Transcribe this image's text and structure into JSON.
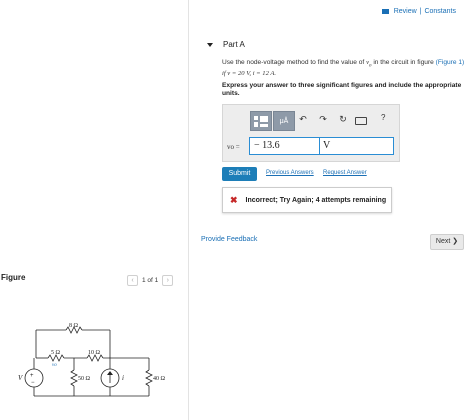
{
  "header": {
    "review_label": "Review",
    "separator": "|",
    "constants_label": "Constants"
  },
  "part": {
    "title": "Part A"
  },
  "problem": {
    "line1_prefix": "Use the node-voltage method to find the value of ",
    "line1_var": "v",
    "line1_sub": "o",
    "line1_mid": " in the circuit in figure ",
    "figure_link": "(Figure 1)",
    "line2": "if v = 20 V, i = 12 A."
  },
  "instructions": "Express your answer to three significant figures and include the appropriate units.",
  "answer": {
    "unit_button_label": "μÅ",
    "help_icon": "?",
    "var_label": "vo =",
    "value": "− 13.6",
    "unit": "V"
  },
  "actions": {
    "submit_label": "Submit",
    "previous_answers_label": "Previous Answers",
    "request_answer_label": "Request Answer"
  },
  "feedback": {
    "message": "Incorrect; Try Again; 4 attempts remaining"
  },
  "provide_feedback_label": "Provide Feedback",
  "next_label": "Next ❯",
  "figure": {
    "title": "Figure",
    "pager": "1 of 1",
    "labels": {
      "r8": "8 Ω",
      "r5": "5 Ω",
      "r10": "10 Ω",
      "r50": "50 Ω",
      "r40": "40 Ω",
      "v": "V",
      "i": "i",
      "vo": "vo"
    }
  },
  "colors": {
    "link": "#1a6fb5",
    "submit": "#1d7eb8",
    "input_border": "#2a8dd4",
    "error": "#c62828"
  },
  "icons": [
    "review-icon",
    "collapse-caret-icon",
    "template-icon",
    "undo-icon",
    "redo-icon",
    "reset-icon",
    "keyboard-icon",
    "help-icon",
    "incorrect-x-icon",
    "prev-page-icon",
    "next-page-icon"
  ]
}
